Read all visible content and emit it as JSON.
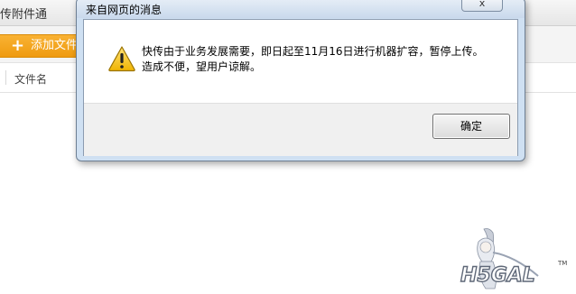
{
  "app": {
    "title": "传附件通",
    "add_file_label": "添加文件",
    "column_filename": "文件名"
  },
  "dialog": {
    "title": "来自网页的消息",
    "close_label": "x",
    "message_line1": "快传由于业务发展需要，即日起至11月16日进行机器扩容，暂停上传。",
    "message_line2": "造成不便，望用户谅解。",
    "ok_label": "确定",
    "icon": "warning-icon"
  },
  "watermark": {
    "text": "H5GAL",
    "tm": "TM"
  }
}
